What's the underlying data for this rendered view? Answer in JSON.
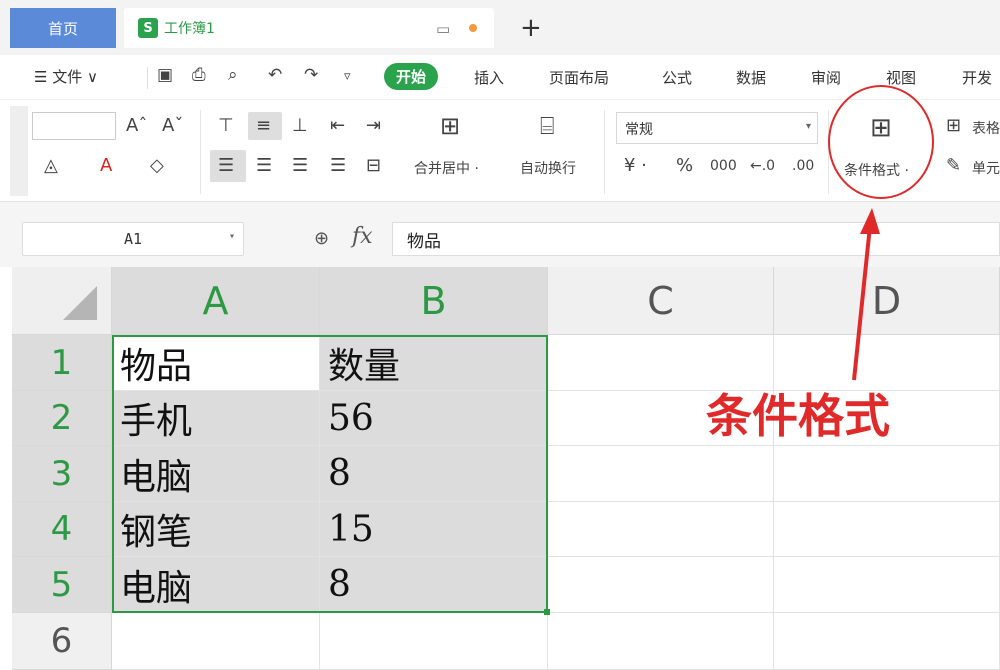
{
  "tabs": {
    "home": "首页",
    "doc_icon": "S",
    "doc_title": "工作簿1",
    "add": "+"
  },
  "menu": {
    "file": "☰ 文件 ∨",
    "tabs": [
      "开始",
      "插入",
      "页面布局",
      "公式",
      "数据",
      "审阅",
      "视图",
      "开发"
    ]
  },
  "ribbon": {
    "merge_center": "合并居中 ·",
    "wrap_text": "自动换行",
    "number_format": "常规",
    "conditional_format": "条件格式 ·",
    "table_style": "表格",
    "cell_style": "单元"
  },
  "formula_bar": {
    "name_box": "A1",
    "fx": "fx",
    "value": "物品"
  },
  "sheet": {
    "columns": [
      "A",
      "B",
      "C",
      "D"
    ],
    "rows": [
      "1",
      "2",
      "3",
      "4",
      "5",
      "6"
    ],
    "data": [
      [
        "物品",
        "数量"
      ],
      [
        "手机",
        "56"
      ],
      [
        "电脑",
        "8"
      ],
      [
        "钢笔",
        "15"
      ],
      [
        "电脑",
        "8"
      ]
    ]
  },
  "annotation": {
    "label": "条件格式",
    "color": "#e02a2a"
  },
  "colors": {
    "accent_green": "#2ba24c",
    "home_tab_blue": "#5b8bd8"
  }
}
